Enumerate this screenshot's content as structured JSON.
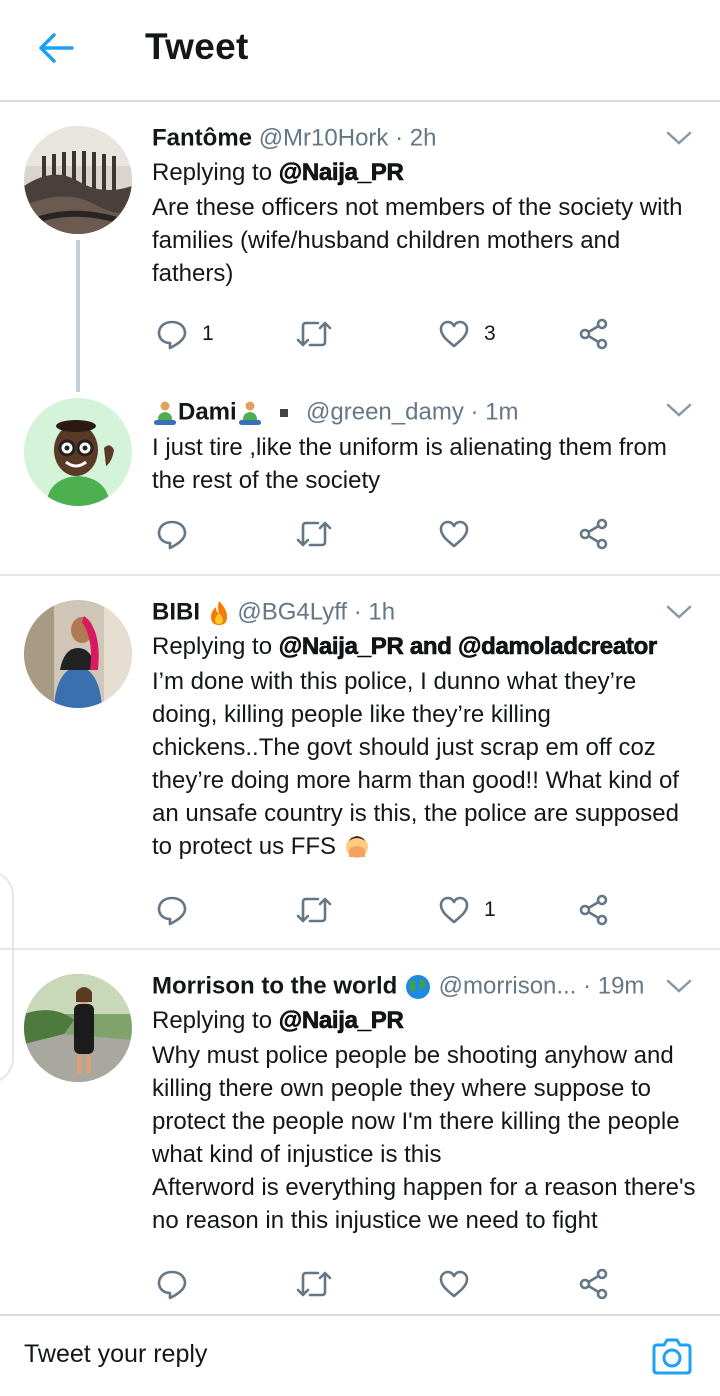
{
  "header": {
    "title": "Tweet"
  },
  "tweets": [
    {
      "name": "Fantôme",
      "handle": "@Mr10Hork",
      "time": "· 2h",
      "replying_prefix": "Replying to",
      "replying_handles": "@Naija_PR",
      "text": "Are these officers not members of the society with families (wife/husband children mothers and fathers)",
      "replies": "1",
      "retweets": "",
      "likes": "3"
    },
    {
      "name": "Dami",
      "handle": "@green_damy",
      "time": "· 1m",
      "text": "I just tire ,like the uniform is alienating them from the rest of the society",
      "replies": "",
      "retweets": "",
      "likes": ""
    },
    {
      "name": "BIBI",
      "handle": "@BG4Lyff",
      "time": "· 1h",
      "replying_prefix": "Replying to",
      "replying_handles": "@Naija_PR and @damoladcreator",
      "text": "I’m done with this police, I dunno what they’re doing, killing people like they’re killing chickens..The govt should just scrap em off coz they’re doing more harm than good!! What kind of an unsafe country is this, the police are supposed to protect us FFS",
      "replies": "",
      "retweets": "",
      "likes": "1"
    },
    {
      "name": "Morrison to the world",
      "handle": "@morrison...",
      "time": "· 19m",
      "replying_prefix": "Replying to",
      "replying_handles": "@Naija_PR",
      "text_lines": [
        "Why must police people be shooting anyhow and killing there own people they where suppose to protect the people now I'm there killing the people what kind of injustice is this",
        "Afterword is everything happen for a reason there's no reason in this injustice we need to fight"
      ],
      "replies": "",
      "retweets": "",
      "likes": ""
    }
  ],
  "reply_bar": {
    "placeholder": "Tweet your reply"
  },
  "colors": {
    "accent": "#1da1f2",
    "icon_gray": "#657786",
    "divider": "#e1e8ed"
  }
}
